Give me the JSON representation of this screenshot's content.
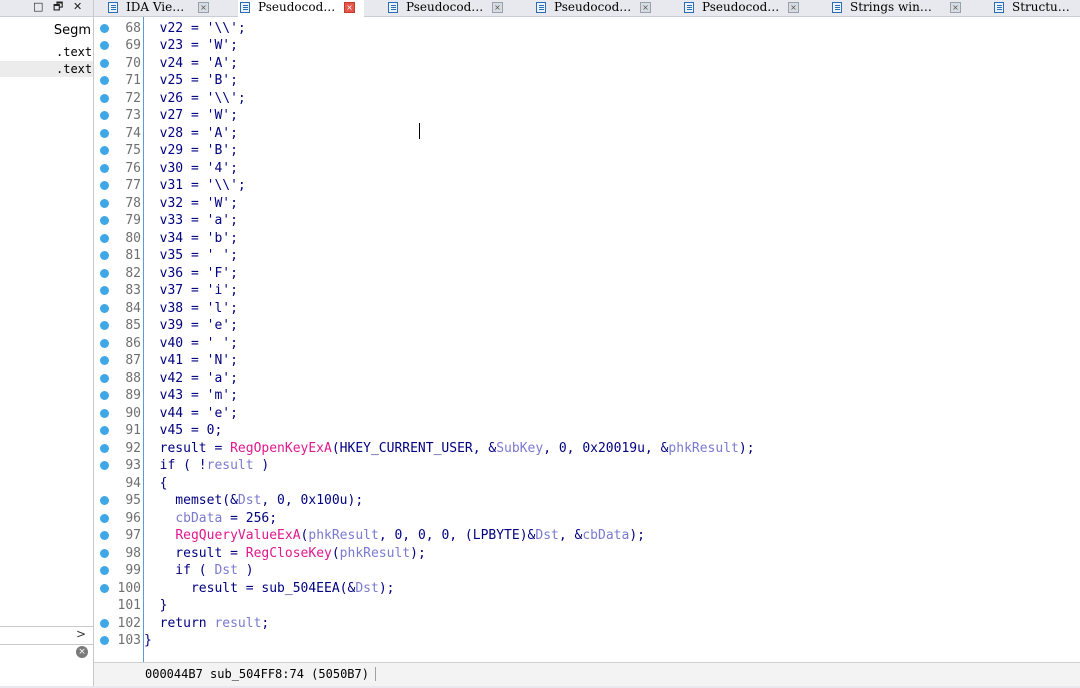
{
  "window_controls": [
    "□",
    "🗗",
    "✕"
  ],
  "segments_panel": {
    "header": "Segm",
    "rows": [
      ".text",
      ".text"
    ],
    "scroll_arrow": ">",
    "clear_icon": "⊗"
  },
  "tabs": [
    {
      "label": "IDA Vie…",
      "active": false
    },
    {
      "label": "Pseudocod…",
      "active": true
    },
    {
      "label": "Pseudocod…",
      "active": false
    },
    {
      "label": "Pseudocod…",
      "active": false
    },
    {
      "label": "Pseudocod…",
      "active": false
    },
    {
      "label": "Strings win…",
      "active": false
    },
    {
      "label": "Structu…",
      "active": false
    }
  ],
  "code": {
    "line_numbers": [
      "68",
      "69",
      "70",
      "71",
      "72",
      "73",
      "74",
      "75",
      "76",
      "77",
      "78",
      "79",
      "80",
      "81",
      "82",
      "83",
      "84",
      "85",
      "86",
      "87",
      "88",
      "89",
      "90",
      "91",
      "92",
      "93",
      "94",
      "95",
      "96",
      "97",
      "98",
      "99",
      "100",
      "101",
      "102",
      "103"
    ],
    "breakpoint_lines": [
      "68",
      "69",
      "70",
      "71",
      "72",
      "73",
      "74",
      "75",
      "76",
      "77",
      "78",
      "79",
      "80",
      "81",
      "82",
      "83",
      "84",
      "85",
      "86",
      "87",
      "88",
      "89",
      "90",
      "91",
      "92",
      "93",
      "95",
      "96",
      "97",
      "98",
      "99",
      "100",
      "102",
      "103"
    ],
    "lines": [
      "  v22 = '\\\\';",
      "  v23 = 'W';",
      "  v24 = 'A';",
      "  v25 = 'B';",
      "  v26 = '\\\\';",
      "  v27 = 'W';",
      "  v28 = 'A';",
      "  v29 = 'B';",
      "  v30 = '4';",
      "  v31 = '\\\\';",
      "  v32 = 'W';",
      "  v33 = 'a';",
      "  v34 = 'b';",
      "  v35 = ' ';",
      "  v36 = 'F';",
      "  v37 = 'i';",
      "  v38 = 'l';",
      "  v39 = 'e';",
      "  v40 = ' ';",
      "  v41 = 'N';",
      "  v42 = 'a';",
      "  v43 = 'm';",
      "  v44 = 'e';",
      "  v45 = 0;",
      "  result = RegOpenKeyExA(HKEY_CURRENT_USER, &SubKey, 0, 0x20019u, &phkResult);",
      "  if ( !result )",
      "  {",
      "    memset(&Dst, 0, 0x100u);",
      "    cbData = 256;",
      "    RegQueryValueExA(phkResult, 0, 0, 0, (LPBYTE)&Dst, &cbData);",
      "    result = RegCloseKey(phkResult);",
      "    if ( Dst )",
      "      result = sub_504EEA(&Dst);",
      "  }",
      "  return result;",
      "}"
    ]
  },
  "status_bar": {
    "text": "000044B7 sub_504FF8:74 (5050B7)"
  }
}
